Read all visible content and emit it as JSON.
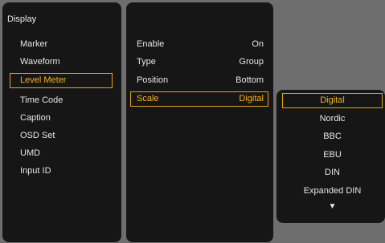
{
  "display_menu": {
    "title": "Display",
    "items": [
      {
        "label": "Marker"
      },
      {
        "label": "Waveform"
      },
      {
        "label": "Level Meter"
      },
      {
        "label": "Time Code"
      },
      {
        "label": "Caption"
      },
      {
        "label": "OSD Set"
      },
      {
        "label": "UMD"
      },
      {
        "label": "Input ID"
      }
    ],
    "selected_index": 2
  },
  "level_meter_menu": {
    "items": [
      {
        "label": "Enable",
        "value": "On"
      },
      {
        "label": "Type",
        "value": "Group"
      },
      {
        "label": "Position",
        "value": "Bottom"
      },
      {
        "label": "Scale",
        "value": "Digital"
      }
    ],
    "selected_index": 3
  },
  "scale_options": {
    "items": [
      "Digital",
      "Nordic",
      "BBC",
      "EBU",
      "DIN",
      "Expanded DIN"
    ],
    "selected_index": 0,
    "more_indicator": "▼"
  },
  "colors": {
    "highlight": "#f4b21f",
    "panel_bg": "#161616",
    "screen_bg": "#6e6e6e"
  }
}
